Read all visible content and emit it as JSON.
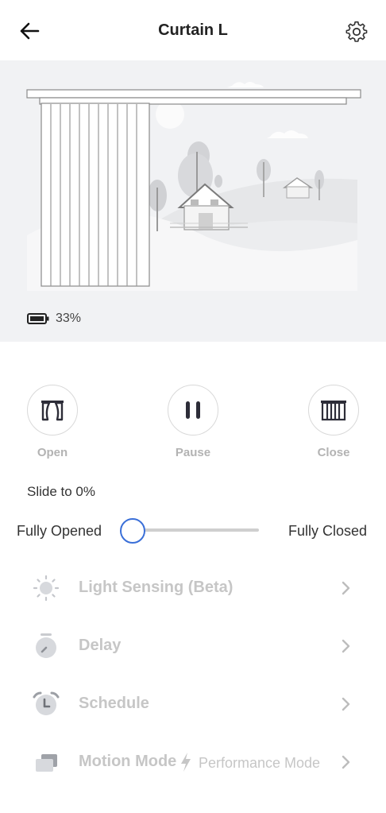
{
  "header": {
    "title": "Curtain L",
    "back_icon": "arrow-left-icon",
    "settings_icon": "gear-icon"
  },
  "status": {
    "battery": "33%",
    "battery_icon": "battery-icon"
  },
  "controls": [
    {
      "label": "Open",
      "icon": "curtain-open-icon"
    },
    {
      "label": "Pause",
      "icon": "pause-icon"
    },
    {
      "label": "Close",
      "icon": "curtain-closed-icon"
    }
  ],
  "slider": {
    "caption": "Slide to 0%",
    "left_label": "Fully Opened",
    "right_label": "Fully Closed",
    "value_percent": 0
  },
  "menu": [
    {
      "label": "Light Sensing (Beta)",
      "icon": "light-sensor-icon",
      "sub": ""
    },
    {
      "label": "Delay",
      "icon": "timer-icon",
      "sub": ""
    },
    {
      "label": "Schedule",
      "icon": "alarm-clock-icon",
      "sub": ""
    },
    {
      "label": "Motion Mode",
      "icon": "motion-mode-icon",
      "sub": "Performance Mode"
    }
  ],
  "colors": {
    "accent": "#3a6fd8",
    "disabled_text": "#c6c6c6",
    "hero_bg": "#f1f2f4"
  }
}
